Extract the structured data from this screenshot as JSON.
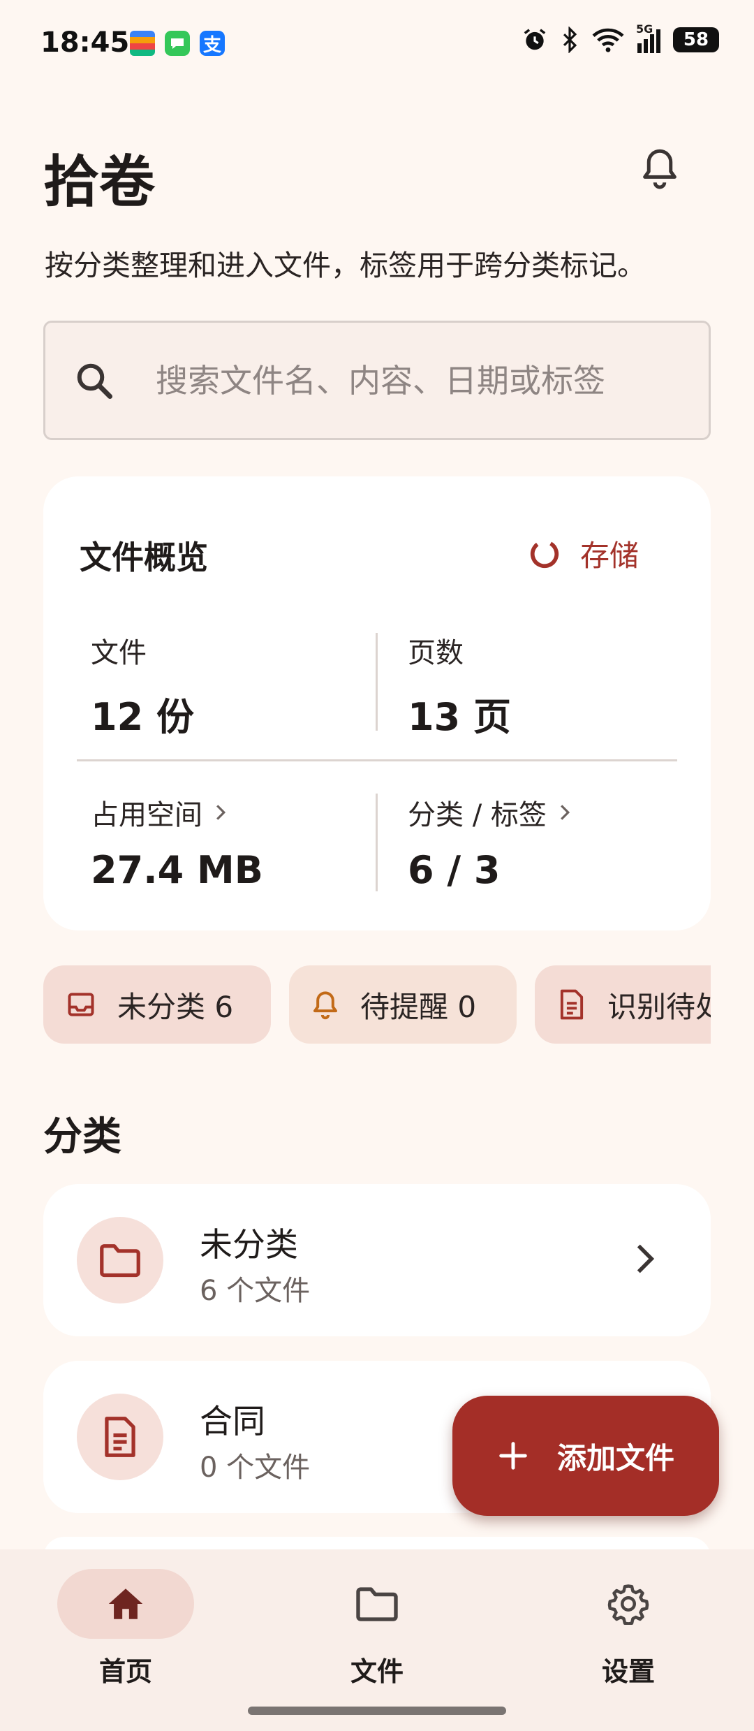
{
  "status_bar": {
    "time": "18:45",
    "battery": "58",
    "network": "5G",
    "icons": [
      "wallet-app-icon",
      "messages-app-icon",
      "alipay-app-icon",
      "alarm-icon",
      "bluetooth-icon",
      "wifi-icon",
      "signal-icon",
      "battery-icon"
    ]
  },
  "header": {
    "title": "拾卷",
    "subtitle": "按分类整理和进入文件，标签用于跨分类标记。"
  },
  "search": {
    "placeholder": "搜索文件名、内容、日期或标签"
  },
  "overview": {
    "title": "文件概览",
    "storage_label": "存储",
    "stats": [
      {
        "label": "文件",
        "value": "12 份"
      },
      {
        "label": "页数",
        "value": "13 页"
      },
      {
        "label": "占用空间",
        "value": "27.4 MB"
      },
      {
        "label": "分类 / 标签",
        "value": "6 / 3"
      }
    ]
  },
  "chips": [
    {
      "label": "未分类 6",
      "icon": "inbox-icon"
    },
    {
      "label": "待提醒 0",
      "icon": "bell-icon"
    },
    {
      "label": "识别待处理",
      "icon": "document-icon"
    }
  ],
  "categories": {
    "title": "分类",
    "items": [
      {
        "name": "未分类",
        "count": "6 个文件",
        "icon": "folder-icon"
      },
      {
        "name": "合同",
        "count": "0 个文件",
        "icon": "document-icon"
      }
    ]
  },
  "fab": {
    "label": "添加文件"
  },
  "nav": [
    {
      "label": "首页",
      "icon": "home-icon",
      "active": true
    },
    {
      "label": "文件",
      "icon": "folder-icon",
      "active": false
    },
    {
      "label": "设置",
      "icon": "gear-icon",
      "active": false
    }
  ],
  "colors": {
    "background": "#FEF7F2",
    "accent": "#A42E27",
    "chip": "#F4DCD5",
    "card": "#FFFFFF"
  }
}
